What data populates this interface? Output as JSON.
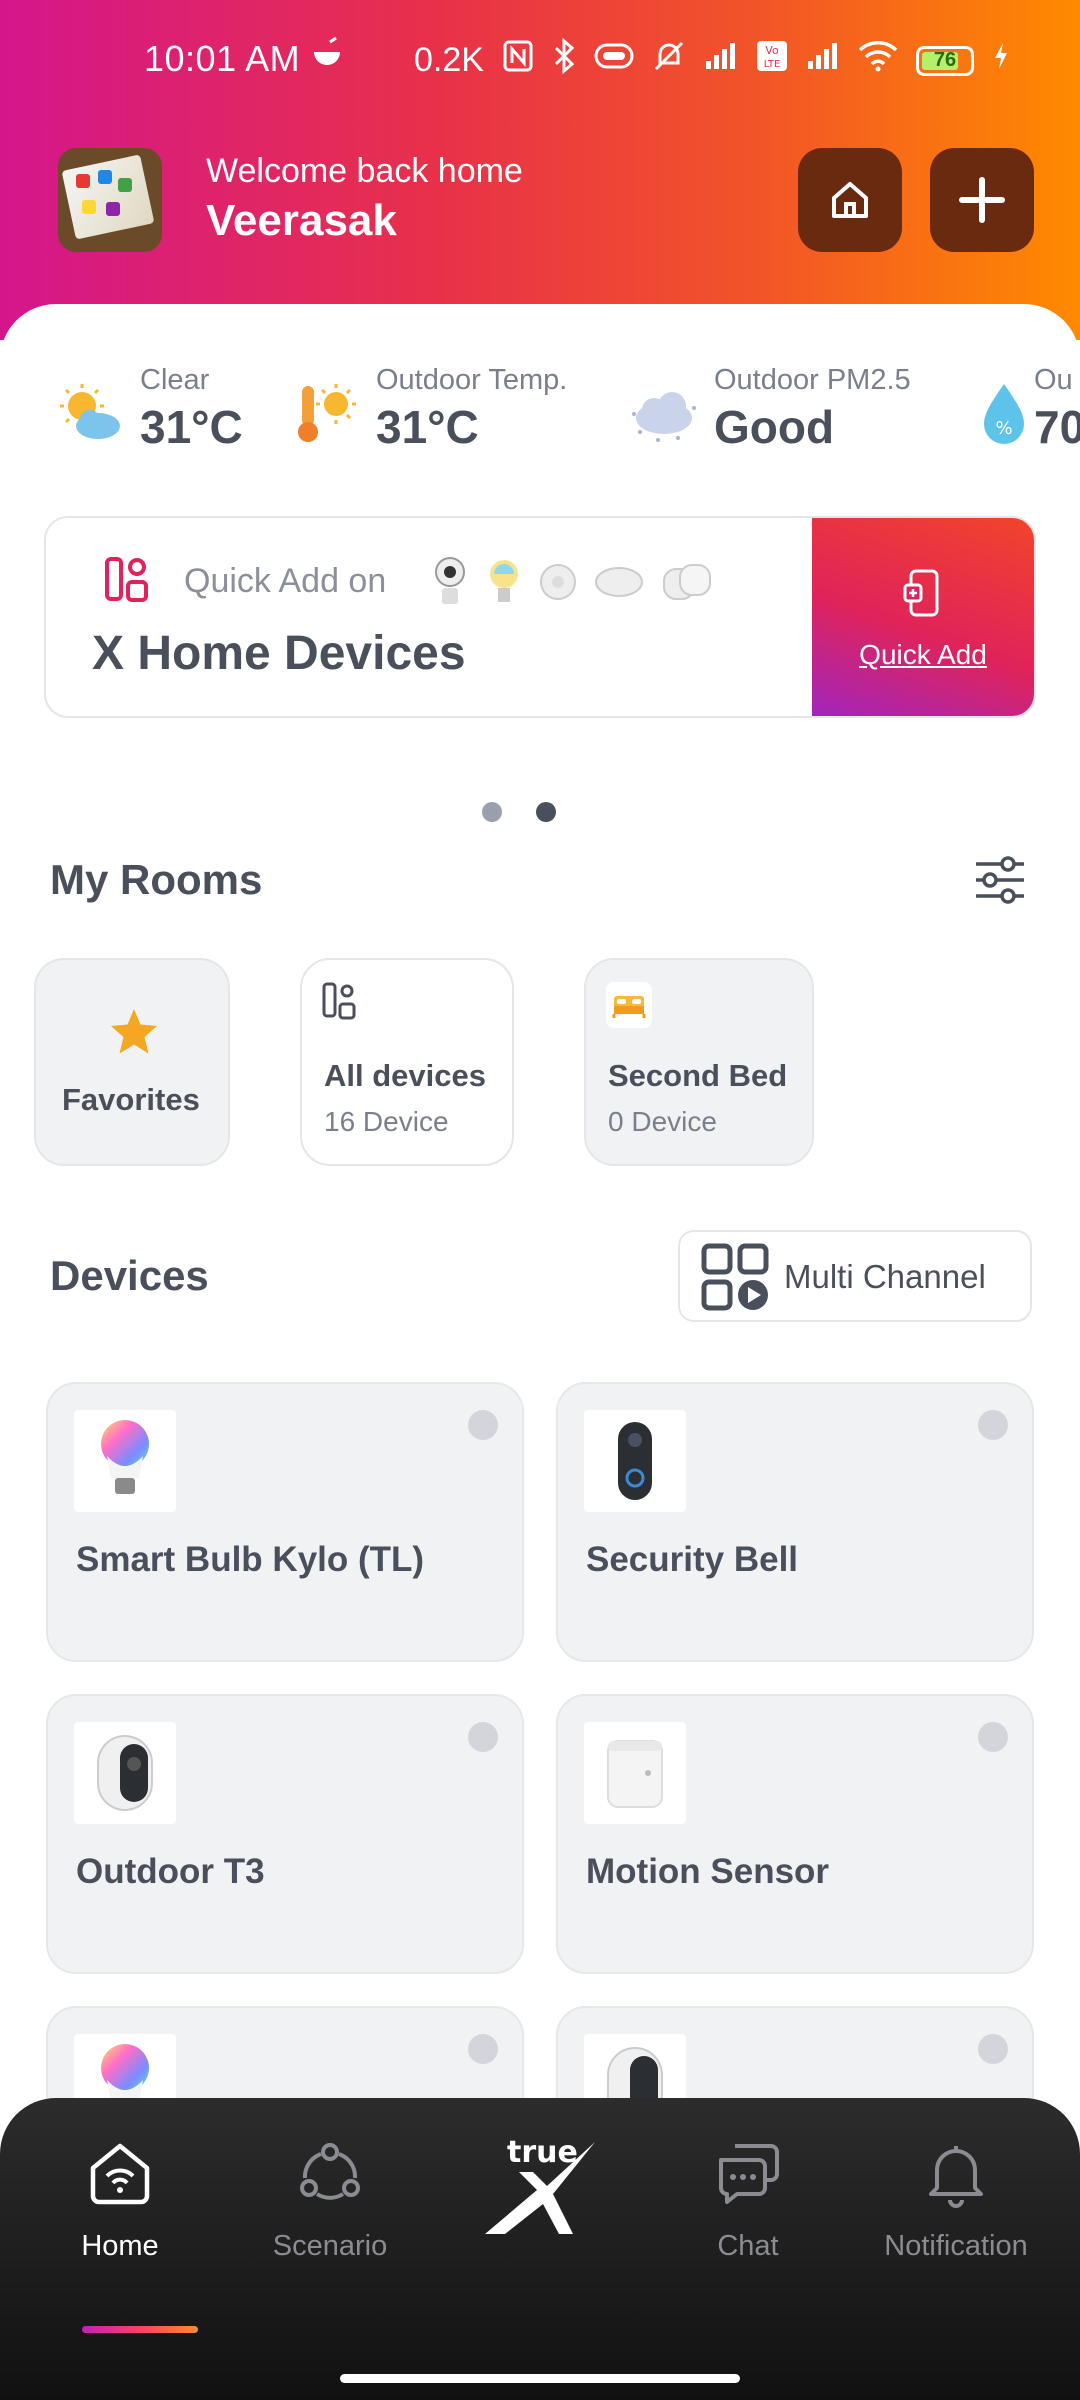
{
  "status_bar": {
    "time": "10:01 AM",
    "net_speed": "0.2K",
    "battery_level": "76"
  },
  "header": {
    "welcome": "Welcome back home",
    "user_name": "Veerasak"
  },
  "weather": [
    {
      "label": "Clear",
      "value": "31°C",
      "icon": "sun-cloud-icon"
    },
    {
      "label": "Outdoor Temp.",
      "value": "31°C",
      "icon": "thermometer-sun-icon"
    },
    {
      "label": "Outdoor PM2.5",
      "value": "Good",
      "icon": "dust-cloud-icon"
    },
    {
      "label": "Ou",
      "value": "70",
      "icon": "humidity-drop-icon"
    }
  ],
  "quick_add": {
    "title": "Quick Add on",
    "subtitle": "X Home Devices",
    "button_label": "Quick Add"
  },
  "carousel": {
    "pages": 2,
    "active_index": 1
  },
  "rooms": {
    "title": "My Rooms",
    "items": [
      {
        "name": "Favorites",
        "count": ""
      },
      {
        "name": "All devices",
        "count": "16 Device"
      },
      {
        "name": "Second Bed",
        "count": "0 Device"
      }
    ]
  },
  "devices": {
    "title": "Devices",
    "multi_channel_label": "Multi Channel",
    "items": [
      {
        "name": "Smart Bulb Kylo (TL)",
        "icon": "smart-bulb-icon"
      },
      {
        "name": "Security Bell",
        "icon": "doorbell-icon"
      },
      {
        "name": "Outdoor T3",
        "icon": "outdoor-camera-icon"
      },
      {
        "name": "Motion Sensor",
        "icon": "motion-sensor-icon"
      },
      {
        "name": "",
        "icon": "smart-bulb-icon"
      },
      {
        "name": "",
        "icon": "outdoor-camera-icon"
      }
    ]
  },
  "nav": {
    "items": [
      {
        "label": "Home",
        "active": true
      },
      {
        "label": "Scenario",
        "active": false
      },
      {
        "label": "",
        "active": false
      },
      {
        "label": "Chat",
        "active": false
      },
      {
        "label": "Notification",
        "active": false
      }
    ],
    "logo_text": "true"
  },
  "colors": {
    "accent_gradient": [
      "#d4168c",
      "#e8304a",
      "#ff8a00"
    ],
    "header_button": "#6a2a10",
    "text_primary": "#4a4f5c",
    "text_secondary": "#7a7f8c",
    "card_bg": "#f1f2f4",
    "star": "#f5a623"
  }
}
